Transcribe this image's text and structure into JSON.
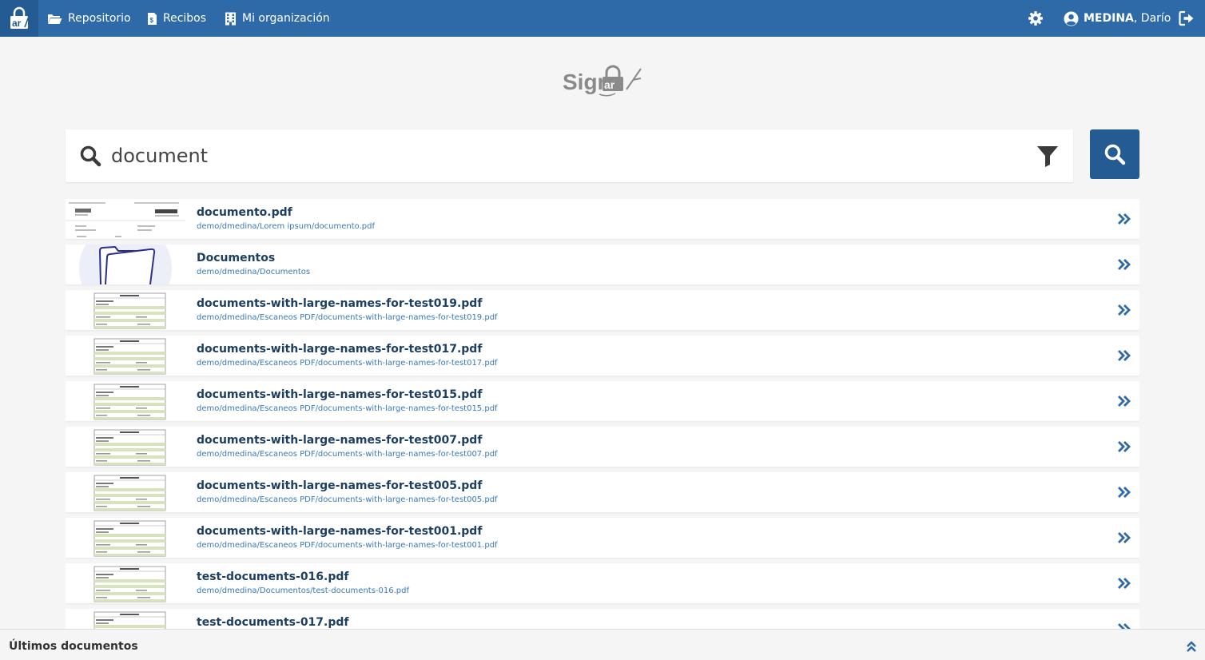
{
  "nav": {
    "repositorio": "Repositorio",
    "recibos": "Recibos",
    "organizacion": "Mi organización"
  },
  "user": {
    "surname": "MEDINA",
    "name": ", Darío"
  },
  "logo": {
    "text": "Sign"
  },
  "search": {
    "value": "document"
  },
  "results": [
    {
      "title": "documento.pdf",
      "path": "demo/dmedina/Lorem ipsum/documento.pdf",
      "thumb": "receipt"
    },
    {
      "title": "Documentos",
      "path": "demo/dmedina/Documentos",
      "thumb": "folder"
    },
    {
      "title": "documents-with-large-names-for-test019.pdf",
      "path": "demo/dmedina/Escaneos PDF/documents-with-large-names-for-test019.pdf",
      "thumb": "form"
    },
    {
      "title": "documents-with-large-names-for-test017.pdf",
      "path": "demo/dmedina/Escaneos PDF/documents-with-large-names-for-test017.pdf",
      "thumb": "form"
    },
    {
      "title": "documents-with-large-names-for-test015.pdf",
      "path": "demo/dmedina/Escaneos PDF/documents-with-large-names-for-test015.pdf",
      "thumb": "form"
    },
    {
      "title": "documents-with-large-names-for-test007.pdf",
      "path": "demo/dmedina/Escaneos PDF/documents-with-large-names-for-test007.pdf",
      "thumb": "form"
    },
    {
      "title": "documents-with-large-names-for-test005.pdf",
      "path": "demo/dmedina/Escaneos PDF/documents-with-large-names-for-test005.pdf",
      "thumb": "form"
    },
    {
      "title": "documents-with-large-names-for-test001.pdf",
      "path": "demo/dmedina/Escaneos PDF/documents-with-large-names-for-test001.pdf",
      "thumb": "form"
    },
    {
      "title": "test-documents-016.pdf",
      "path": "demo/dmedina/Documentos/test-documents-016.pdf",
      "thumb": "form"
    },
    {
      "title": "test-documents-017.pdf",
      "path": "",
      "thumb": "form"
    }
  ],
  "footer": {
    "label": "Últimos documentos"
  },
  "colors": {
    "primary": "#2e6aa8",
    "primary_dark": "#245b93",
    "title": "#1d3f63",
    "path": "#3a78b8"
  },
  "icons": [
    "app-logo-icon",
    "folder-open-icon",
    "receipt-icon",
    "building-icon",
    "gear-icon",
    "user-circle-icon",
    "sign-out-icon",
    "search-icon",
    "filter-icon",
    "double-chevron-right-icon",
    "double-chevron-up-icon"
  ]
}
